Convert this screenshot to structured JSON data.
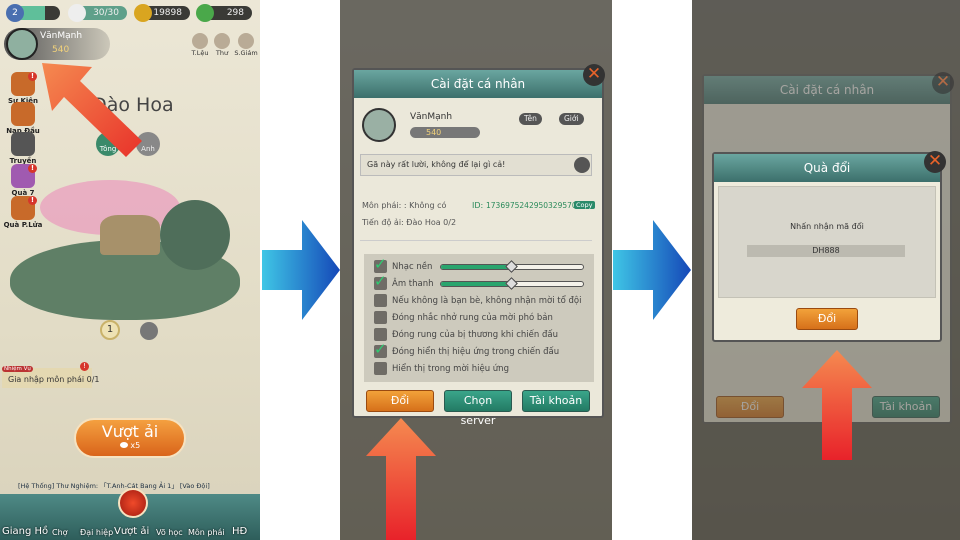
{
  "panel1": {
    "resources": {
      "level": "2",
      "stamina": "30/30",
      "coins": "19898",
      "gems": "298"
    },
    "player": {
      "name": "VănMạnh",
      "power": "540"
    },
    "top_icons": [
      "T.Lệu",
      "Thư",
      "S.Giám"
    ],
    "side_menu": [
      "Sự Kiện",
      "Nạp Đầu",
      "Truyền Lửa",
      "Quà 7 Ngày",
      "Quà P.Lửa"
    ],
    "map_title": "Đào Hoa",
    "map_nodes": [
      "Tông",
      "Anh"
    ],
    "stage_marker": "1",
    "quest": {
      "tag": "Nhiệm Vụ",
      "text": "Gia nhập môn phái 0/1"
    },
    "challenge": {
      "label": "Vượt ải",
      "cost": "x5"
    },
    "chat": "[Hệ Thống] Thư Nghiệm: 「T.Anh-Cát Bang Ải 1」 [Vào Đội]",
    "nav": [
      "Giang Hồ",
      "Chợ",
      "Đại hiệp",
      "Vượt ải",
      "Võ học",
      "Môn phái",
      "HĐ"
    ]
  },
  "panel2": {
    "dialog_title": "Cài đặt cá nhân",
    "name": "VănMạnh",
    "power": "540",
    "rename": "Tên",
    "gender": "Giới",
    "signature": "Gã này rất lười, không để lại gì cả!",
    "sect": "Môn phái: : Không có",
    "id_label": "ID:",
    "id_value": "1736975242950329570",
    "copy": "Copy",
    "progress": "Tiến độ ải: Đào Hoa 0/2",
    "settings": [
      {
        "label": "Nhạc nền",
        "checked": true,
        "level": 0.5
      },
      {
        "label": "Âm thanh",
        "checked": true,
        "level": 0.5
      },
      {
        "label": "Nếu không là bạn bè, không nhận mời tổ đội",
        "checked": false
      },
      {
        "label": "Đóng nhắc nhở rung của mời phó bản",
        "checked": false
      },
      {
        "label": "Đóng rung của bị thương khi chiến đấu",
        "checked": false
      },
      {
        "label": "Đóng hiển thị hiệu ứng trong chiến đấu",
        "checked": true
      },
      {
        "label": "Hiển thị trong mời hiệu ứng",
        "checked": false
      }
    ],
    "buttons": {
      "redeem": "Đổi",
      "server": "Chọn server",
      "account": "Tài khoản"
    }
  },
  "panel3": {
    "dialog_title": "Quà đổi",
    "prompt": "Nhấn nhận mã đổi",
    "code": "DH888",
    "confirm": "Đổi"
  },
  "colors": {
    "accent_orange": "#e8862a",
    "teal": "#2f8a74",
    "arrow_red": "#f05a3a",
    "arrow_blue": "#1e7fd6"
  }
}
